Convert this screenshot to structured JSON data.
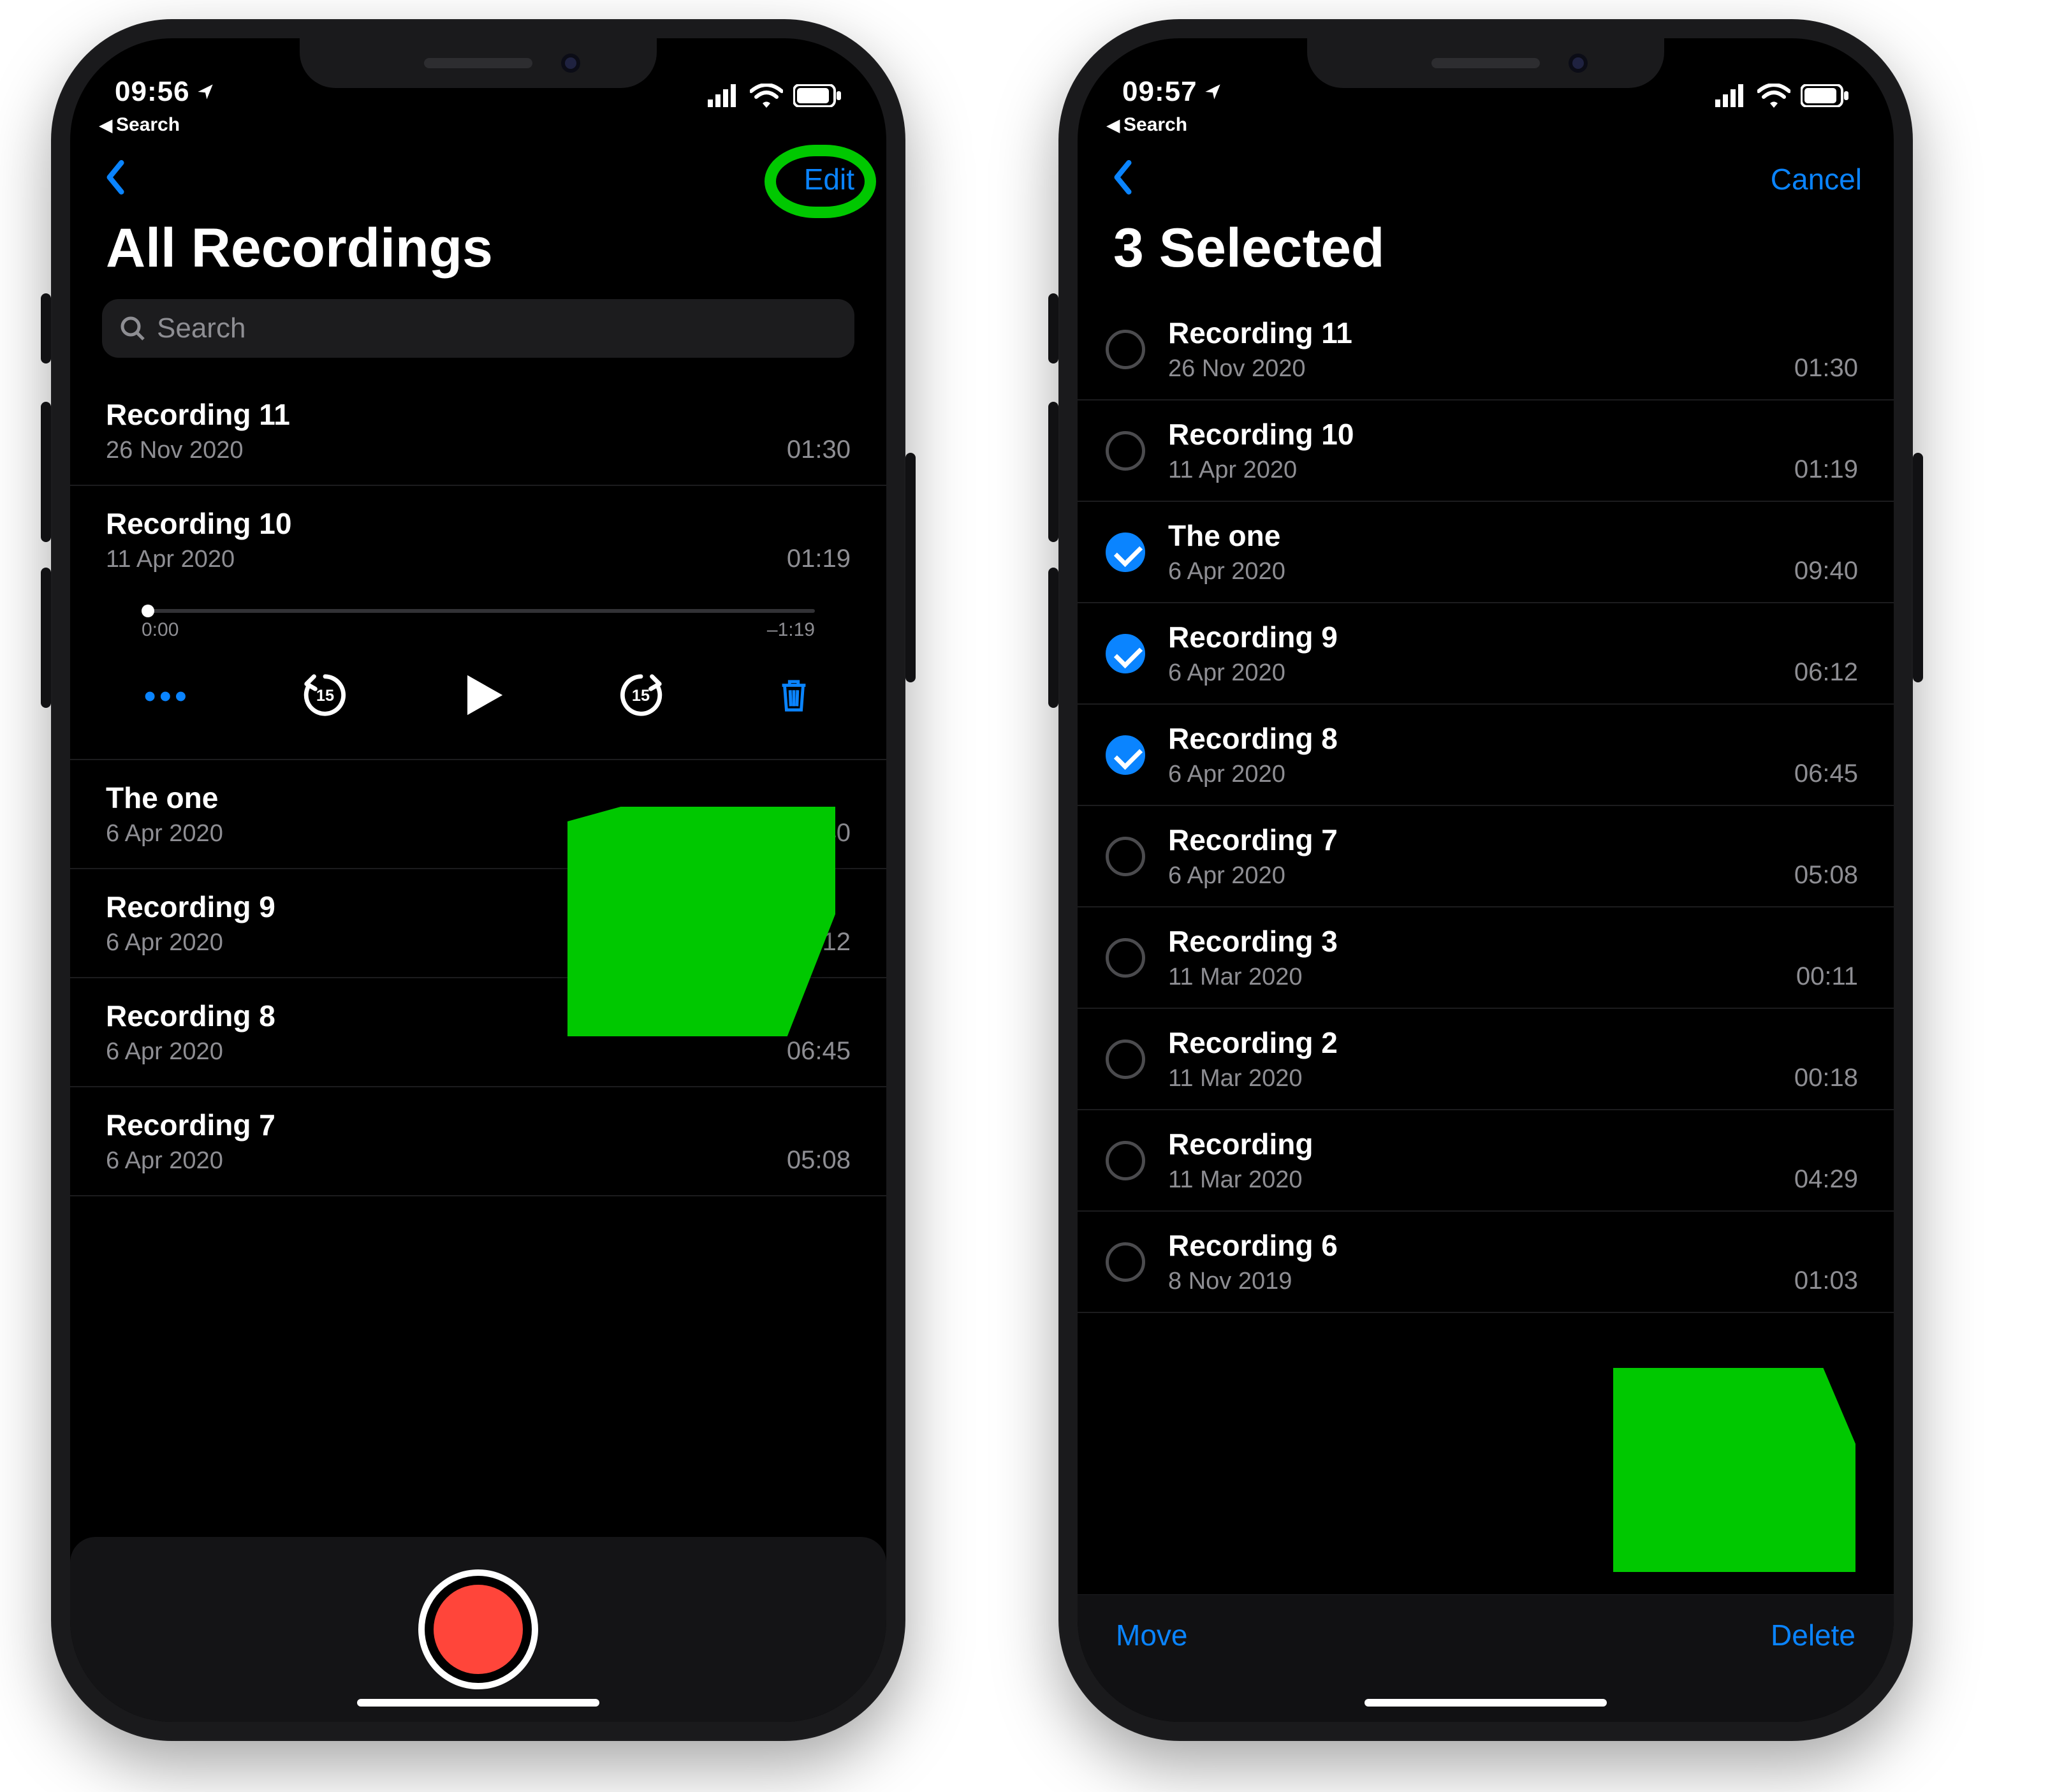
{
  "left": {
    "status": {
      "time": "09:56",
      "breadcrumb": "Search"
    },
    "nav": {
      "right": "Edit"
    },
    "title": "All Recordings",
    "search": {
      "placeholder": "Search"
    },
    "recordings": [
      {
        "title": "Recording 11",
        "date": "26 Nov 2020",
        "dur": "01:30"
      },
      {
        "title": "Recording 10",
        "date": "11 Apr 2020",
        "dur": "01:19"
      },
      {
        "title": "The one",
        "date": "6 Apr 2020",
        "dur": "09:40"
      },
      {
        "title": "Recording 9",
        "date": "6 Apr 2020",
        "dur": "06:12"
      },
      {
        "title": "Recording 8",
        "date": "6 Apr 2020",
        "dur": "06:45"
      },
      {
        "title": "Recording 7",
        "date": "6 Apr 2020",
        "dur": "05:08"
      }
    ],
    "playback": {
      "elapsed": "0:00",
      "remaining": "–1:19",
      "skip": "15"
    }
  },
  "right": {
    "status": {
      "time": "09:57",
      "breadcrumb": "Search"
    },
    "nav": {
      "right": "Cancel"
    },
    "title": "3 Selected",
    "recordings": [
      {
        "title": "Recording 11",
        "date": "26 Nov 2020",
        "dur": "01:30",
        "selected": false
      },
      {
        "title": "Recording 10",
        "date": "11 Apr 2020",
        "dur": "01:19",
        "selected": false
      },
      {
        "title": "The one",
        "date": "6 Apr 2020",
        "dur": "09:40",
        "selected": true
      },
      {
        "title": "Recording 9",
        "date": "6 Apr 2020",
        "dur": "06:12",
        "selected": true
      },
      {
        "title": "Recording 8",
        "date": "6 Apr 2020",
        "dur": "06:45",
        "selected": true
      },
      {
        "title": "Recording 7",
        "date": "6 Apr 2020",
        "dur": "05:08",
        "selected": false
      },
      {
        "title": "Recording 3",
        "date": "11 Mar 2020",
        "dur": "00:11",
        "selected": false
      },
      {
        "title": "Recording 2",
        "date": "11 Mar 2020",
        "dur": "00:18",
        "selected": false
      },
      {
        "title": "Recording",
        "date": "11 Mar 2020",
        "dur": "04:29",
        "selected": false
      },
      {
        "title": "Recording 6",
        "date": "8 Nov 2019",
        "dur": "01:03",
        "selected": false
      }
    ],
    "toolbar": {
      "move": "Move",
      "delete": "Delete"
    }
  }
}
